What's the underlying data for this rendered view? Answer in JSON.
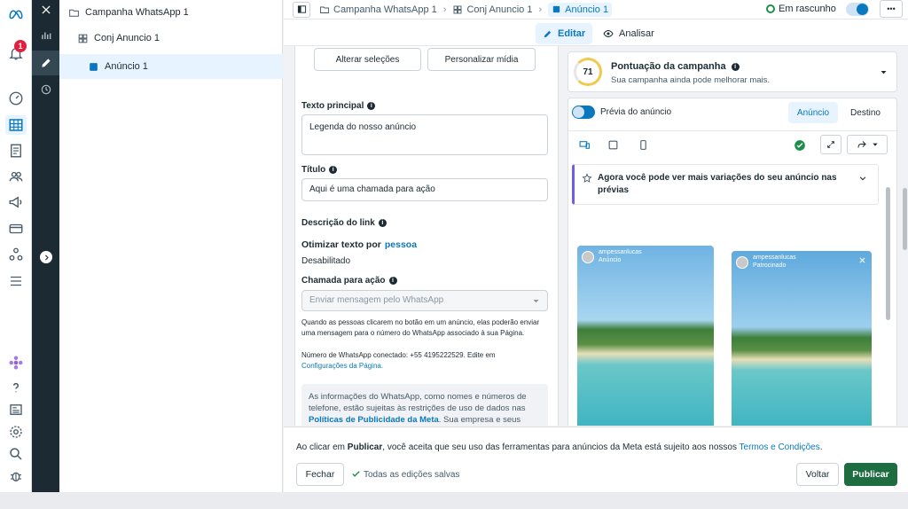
{
  "sidebar": {
    "notification_count": "1"
  },
  "tree": {
    "campaign": "Campanha WhatsApp 1",
    "adset": "Conj Anuncio 1",
    "ad": "Anúncio 1"
  },
  "topbar": {
    "crumbs": [
      "Campanha WhatsApp 1",
      "Conj Anuncio 1",
      "Anúncio 1"
    ],
    "status": "Em rascunho",
    "more": "•••"
  },
  "tabs": {
    "edit": "Editar",
    "analyze": "Analisar"
  },
  "editor": {
    "btn_change": "Alterar seleções",
    "btn_customize": "Personalizar mídia",
    "primary_text_label": "Texto principal",
    "primary_text_value": "Legenda do nosso anúncio",
    "title_label": "Título",
    "title_value": "Aqui é uma chamada para ação",
    "link_desc_label": "Descrição do link",
    "optimize_label": "Otimizar texto por",
    "optimize_link": "pessoa",
    "optimize_value": "Desabilitado",
    "cta_label": "Chamada para ação",
    "cta_value": "Enviar mensagem pelo WhatsApp",
    "cta_help": "Quando as pessoas clicarem no botão em um anúncio, elas poderão enviar uma mensagem para o número do WhatsApp associado à sua Página.",
    "whatsapp_number": "Número de WhatsApp conectado: +55 4195222529. Edite em",
    "whatsapp_link": "Configurações da Página.",
    "notice_text": "As informações do WhatsApp, como nomes e números de telefone, estão sujeitas às restrições de uso de dados nas",
    "notice_link": "Políticas de Publicidade da Meta",
    "notice_tail": ". Sua empresa e seus"
  },
  "preview": {
    "score": "71",
    "score_title": "Pontuação da campanha",
    "score_sub": "Sua campanha ainda pode melhorar mais.",
    "toggle_label": "Prévia do anúncio",
    "tab_ad": "Anúncio",
    "tab_dest": "Destino",
    "banner": "Agora você pode ver mais variações do seu anúncio nas prévias",
    "card1_user": "ampessanlucas",
    "card1_sub": "Anúncio",
    "card2_user": "ampessanlucas",
    "card2_sub": "Patrocinado"
  },
  "footer": {
    "terms_pre": "Ao clicar em ",
    "terms_bold": "Publicar",
    "terms_mid": ", você aceita que seu uso das ferramentas para anúncios da Meta está sujeito aos nossos ",
    "terms_link": "Termos e Condições",
    "terms_end": ".",
    "close": "Fechar",
    "saved": "Todas as edições salvas",
    "back": "Voltar",
    "publish": "Publicar"
  },
  "colors": {
    "accent": "#0a78be",
    "publish": "#1d6d40",
    "toggle": "#0a78be",
    "dark_strip": "#1c2b33"
  }
}
